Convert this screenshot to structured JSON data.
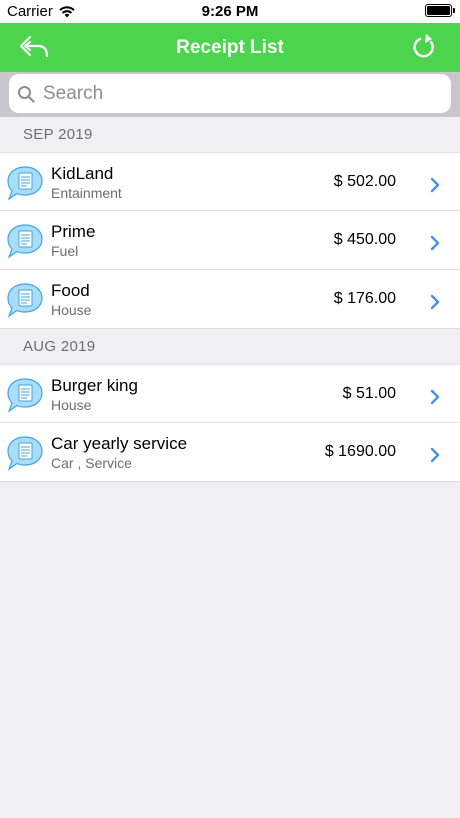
{
  "status_bar": {
    "carrier": "Carrier",
    "time": "9:26 PM"
  },
  "navbar": {
    "title": "Receipt List",
    "back_icon": "reply-arrow-icon",
    "refresh_icon": "refresh-icon"
  },
  "search": {
    "placeholder": "Search",
    "value": ""
  },
  "sections": [
    {
      "header": "SEP 2019",
      "rows": [
        {
          "name": "KidLand",
          "category": "Entainment",
          "amount": "$ 502.00"
        },
        {
          "name": "Prime",
          "category": "Fuel",
          "amount": "$ 450.00"
        },
        {
          "name": "Food",
          "category": "House",
          "amount": "$ 176.00"
        }
      ]
    },
    {
      "header": "AUG 2019",
      "rows": [
        {
          "name": "Burger king",
          "category": "House",
          "amount": "$ 51.00"
        },
        {
          "name": "Car yearly service",
          "category": "Car , Service",
          "amount": "$ 1690.00"
        }
      ]
    }
  ],
  "colors": {
    "accent": "#4cd44f",
    "chevron": "#4a90e2",
    "icon_fill": "#a8dcf8"
  }
}
